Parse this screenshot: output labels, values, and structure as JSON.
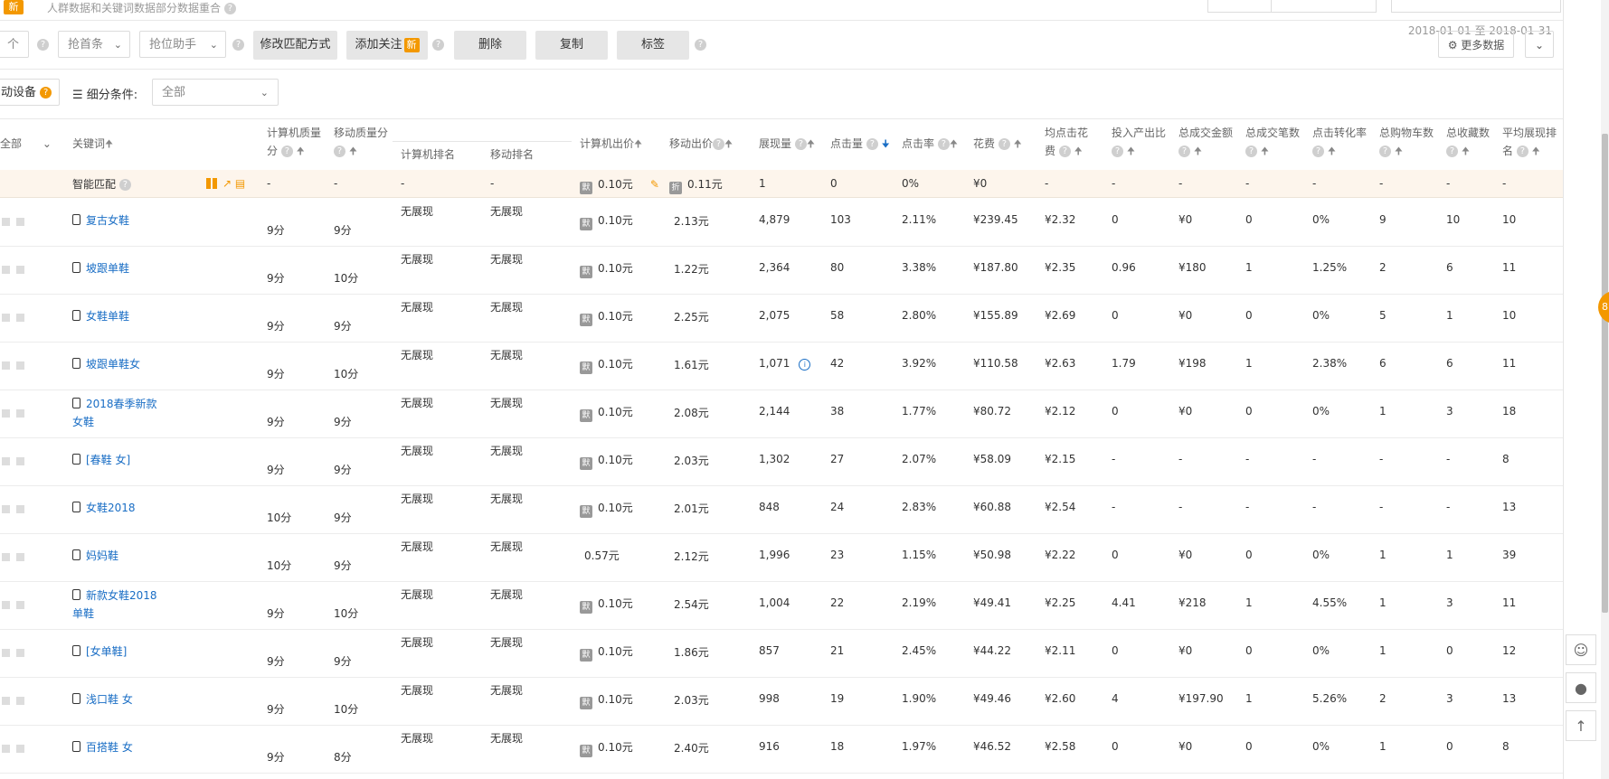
{
  "top": {
    "new_badge": "新",
    "note": "人群数据和关键词数据部分数据重合",
    "date_range": "2018-01-01 至 2018-01-31"
  },
  "toolbar": {
    "sel_first": "个",
    "sel_grab": "抢首条",
    "sel_assist": "抢位助手",
    "btn_modify_match": "修改匹配方式",
    "btn_add_follow": "添加关注",
    "new_label": "新",
    "btn_delete": "删除",
    "btn_copy": "复制",
    "btn_tag": "标签",
    "btn_more_data": "更多数据"
  },
  "filter": {
    "device": "动设备",
    "segment_label": "细分条件:",
    "segment_value": "全部"
  },
  "header": {
    "col_all": "全部",
    "keyword": "关键词",
    "pc_quality_1": "计算机质量",
    "pc_quality_2": "分",
    "mobile_quality": "移动质量分",
    "pc_rank": "计算机排名",
    "mobile_rank": "移动排名",
    "pc_bid": "计算机出价",
    "mobile_bid": "移动出价",
    "impressions": "展现量",
    "clicks": "点击量",
    "ctr": "点击率",
    "cost": "花费",
    "avg_cpc_1": "均点击花",
    "avg_cpc_2": "费",
    "roi": "投入产出比",
    "gmv": "总成交金额",
    "orders": "总成交笔数",
    "cvr": "点击转化率",
    "carts": "总购物车数",
    "favs": "总收藏数",
    "avg_rank_1": "平均展现排",
    "avg_rank_2": "名"
  },
  "smart_row": {
    "label": "智能匹配",
    "q1": "-",
    "q2": "-",
    "r1": "-",
    "r2": "-",
    "bid_tag": "默",
    "pc_bid": "0.10元",
    "mobile_tag": "折",
    "mobile_bid": "0.11元",
    "impressions": "1",
    "clicks": "0",
    "ctr": "0%",
    "cost": "¥0",
    "rest": [
      "-",
      "-",
      "-",
      "-",
      "-",
      "-",
      "-",
      "-"
    ]
  },
  "rows": [
    {
      "kw1": "复古女鞋",
      "kw2": "",
      "pq": "9分",
      "mq": "9分",
      "pr": "无展现",
      "mr": "无展现",
      "tag": "默",
      "pbid": "0.10元",
      "mbid": "2.13元",
      "imp": "4,879",
      "clk": "103",
      "ctr": "2.11%",
      "cost": "¥239.45",
      "cpc": "¥2.32",
      "roi": "0",
      "gmv": "¥0",
      "ord": "0",
      "cvr": "0%",
      "cart": "9",
      "fav": "10",
      "rank": "10",
      "info": false
    },
    {
      "kw1": "坡跟单鞋",
      "kw2": "",
      "pq": "9分",
      "mq": "10分",
      "pr": "无展现",
      "mr": "无展现",
      "tag": "默",
      "pbid": "0.10元",
      "mbid": "1.22元",
      "imp": "2,364",
      "clk": "80",
      "ctr": "3.38%",
      "cost": "¥187.80",
      "cpc": "¥2.35",
      "roi": "0.96",
      "gmv": "¥180",
      "ord": "1",
      "cvr": "1.25%",
      "cart": "2",
      "fav": "6",
      "rank": "11",
      "info": false
    },
    {
      "kw1": "女鞋单鞋",
      "kw2": "",
      "pq": "9分",
      "mq": "9分",
      "pr": "无展现",
      "mr": "无展现",
      "tag": "默",
      "pbid": "0.10元",
      "mbid": "2.25元",
      "imp": "2,075",
      "clk": "58",
      "ctr": "2.80%",
      "cost": "¥155.89",
      "cpc": "¥2.69",
      "roi": "0",
      "gmv": "¥0",
      "ord": "0",
      "cvr": "0%",
      "cart": "5",
      "fav": "1",
      "rank": "10",
      "info": false
    },
    {
      "kw1": "坡跟单鞋女",
      "kw2": "",
      "pq": "9分",
      "mq": "10分",
      "pr": "无展现",
      "mr": "无展现",
      "tag": "默",
      "pbid": "0.10元",
      "mbid": "1.61元",
      "imp": "1,071",
      "clk": "42",
      "ctr": "3.92%",
      "cost": "¥110.58",
      "cpc": "¥2.63",
      "roi": "1.79",
      "gmv": "¥198",
      "ord": "1",
      "cvr": "2.38%",
      "cart": "6",
      "fav": "6",
      "rank": "11",
      "info": true
    },
    {
      "kw1": "2018春季新款",
      "kw2": "女鞋",
      "pq": "9分",
      "mq": "9分",
      "pr": "无展现",
      "mr": "无展现",
      "tag": "默",
      "pbid": "0.10元",
      "mbid": "2.08元",
      "imp": "2,144",
      "clk": "38",
      "ctr": "1.77%",
      "cost": "¥80.72",
      "cpc": "¥2.12",
      "roi": "0",
      "gmv": "¥0",
      "ord": "0",
      "cvr": "0%",
      "cart": "1",
      "fav": "3",
      "rank": "18",
      "info": false
    },
    {
      "kw1": "[春鞋 女]",
      "kw2": "",
      "pq": "9分",
      "mq": "9分",
      "pr": "无展现",
      "mr": "无展现",
      "tag": "默",
      "pbid": "0.10元",
      "mbid": "2.03元",
      "imp": "1,302",
      "clk": "27",
      "ctr": "2.07%",
      "cost": "¥58.09",
      "cpc": "¥2.15",
      "roi": "-",
      "gmv": "-",
      "ord": "-",
      "cvr": "-",
      "cart": "-",
      "fav": "-",
      "rank": "8",
      "info": false
    },
    {
      "kw1": "女鞋2018",
      "kw2": "",
      "pq": "10分",
      "mq": "9分",
      "pr": "无展现",
      "mr": "无展现",
      "tag": "默",
      "pbid": "0.10元",
      "mbid": "2.01元",
      "imp": "848",
      "clk": "24",
      "ctr": "2.83%",
      "cost": "¥60.88",
      "cpc": "¥2.54",
      "roi": "-",
      "gmv": "-",
      "ord": "-",
      "cvr": "-",
      "cart": "-",
      "fav": "-",
      "rank": "13",
      "info": false
    },
    {
      "kw1": "妈妈鞋",
      "kw2": "",
      "pq": "10分",
      "mq": "9分",
      "pr": "无展现",
      "mr": "无展现",
      "tag": "",
      "pbid": "0.57元",
      "mbid": "2.12元",
      "imp": "1,996",
      "clk": "23",
      "ctr": "1.15%",
      "cost": "¥50.98",
      "cpc": "¥2.22",
      "roi": "0",
      "gmv": "¥0",
      "ord": "0",
      "cvr": "0%",
      "cart": "1",
      "fav": "1",
      "rank": "39",
      "info": false
    },
    {
      "kw1": "新款女鞋2018",
      "kw2": "单鞋",
      "pq": "9分",
      "mq": "10分",
      "pr": "无展现",
      "mr": "无展现",
      "tag": "默",
      "pbid": "0.10元",
      "mbid": "2.54元",
      "imp": "1,004",
      "clk": "22",
      "ctr": "2.19%",
      "cost": "¥49.41",
      "cpc": "¥2.25",
      "roi": "4.41",
      "gmv": "¥218",
      "ord": "1",
      "cvr": "4.55%",
      "cart": "1",
      "fav": "3",
      "rank": "11",
      "info": false
    },
    {
      "kw1": "[女单鞋]",
      "kw2": "",
      "pq": "9分",
      "mq": "9分",
      "pr": "无展现",
      "mr": "无展现",
      "tag": "默",
      "pbid": "0.10元",
      "mbid": "1.86元",
      "imp": "857",
      "clk": "21",
      "ctr": "2.45%",
      "cost": "¥44.22",
      "cpc": "¥2.11",
      "roi": "0",
      "gmv": "¥0",
      "ord": "0",
      "cvr": "0%",
      "cart": "1",
      "fav": "0",
      "rank": "12",
      "info": false
    },
    {
      "kw1": "浅口鞋 女",
      "kw2": "",
      "pq": "9分",
      "mq": "10分",
      "pr": "无展现",
      "mr": "无展现",
      "tag": "默",
      "pbid": "0.10元",
      "mbid": "2.03元",
      "imp": "998",
      "clk": "19",
      "ctr": "1.90%",
      "cost": "¥49.46",
      "cpc": "¥2.60",
      "roi": "4",
      "gmv": "¥197.90",
      "ord": "1",
      "cvr": "5.26%",
      "cart": "2",
      "fav": "3",
      "rank": "13",
      "info": false
    },
    {
      "kw1": "百搭鞋 女",
      "kw2": "",
      "pq": "9分",
      "mq": "8分",
      "pr": "无展现",
      "mr": "无展现",
      "tag": "默",
      "pbid": "0.10元",
      "mbid": "2.40元",
      "imp": "916",
      "clk": "18",
      "ctr": "1.97%",
      "cost": "¥46.52",
      "cpc": "¥2.58",
      "roi": "0",
      "gmv": "¥0",
      "ord": "0",
      "cvr": "0%",
      "cart": "1",
      "fav": "0",
      "rank": "8",
      "info": false
    }
  ],
  "side": {
    "float_tab": "8"
  }
}
